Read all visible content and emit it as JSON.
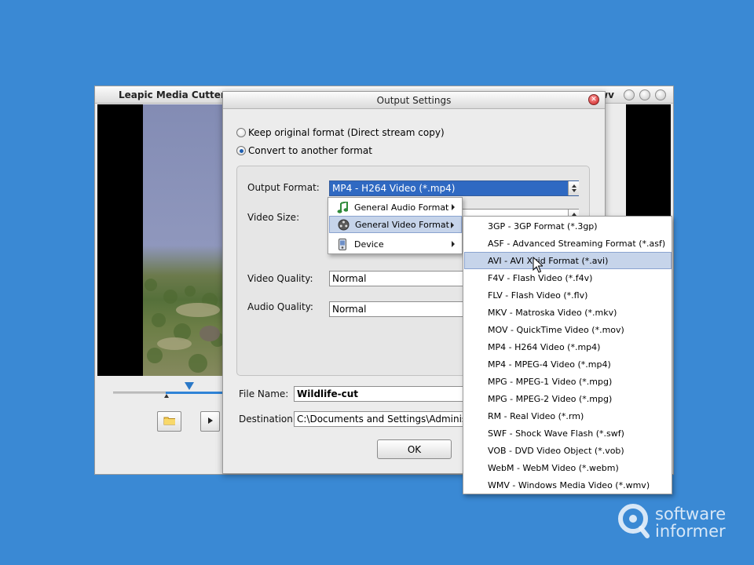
{
  "main_window": {
    "title": "Leapic Media Cutter -",
    "title_tail": "wv"
  },
  "dialog": {
    "title": "Output Settings",
    "radio_keep": "Keep original format (Direct stream copy)",
    "radio_convert": "Convert to another format",
    "output_format_label": "Output Format:",
    "output_format_value": "MP4 - H264 Video (*.mp4)",
    "video_size_label": "Video Size:",
    "video_quality_label": "Video Quality:",
    "video_quality_value": "Normal",
    "audio_quality_label": "Audio Quality:",
    "audio_quality_value": "Normal",
    "file_name_label": "File Name:",
    "file_name_value": "Wildlife-cut",
    "destination_label": "Destination:",
    "destination_value": "C:\\Documents and Settings\\Administra",
    "ok_label": "OK"
  },
  "category_menu": {
    "items": [
      {
        "label": "General Audio Format",
        "icon": "music-note-icon"
      },
      {
        "label": "General Video Format",
        "icon": "film-reel-icon",
        "highlighted": true
      },
      {
        "label": "Device",
        "icon": "device-icon"
      }
    ]
  },
  "format_menu": {
    "items": [
      "3GP - 3GP Format (*.3gp)",
      "ASF - Advanced Streaming Format (*.asf)",
      "AVI - AVI Xvid Format (*.avi)",
      "F4V - Flash Video (*.f4v)",
      "FLV - Flash Video (*.flv)",
      "MKV - Matroska Video (*.mkv)",
      "MOV - QuickTime Video (*.mov)",
      "MP4 - H264 Video (*.mp4)",
      "MP4 - MPEG-4 Video (*.mp4)",
      "MPG - MPEG-1 Video (*.mpg)",
      "MPG - MPEG-2 Video (*.mpg)",
      "RM - Real Video (*.rm)",
      "SWF - Shock Wave Flash (*.swf)",
      "VOB - DVD Video Object (*.vob)",
      "WebM - WebM Video (*.webm)",
      "WMV - Windows Media Video (*.wmv)"
    ],
    "highlighted_index": 2
  },
  "watermark": {
    "line1": "software",
    "line2": "informer"
  },
  "colors": {
    "desktop": "#3a89d4",
    "selection": "#2f69c2",
    "menu_highlight": "#c6d4ea"
  }
}
